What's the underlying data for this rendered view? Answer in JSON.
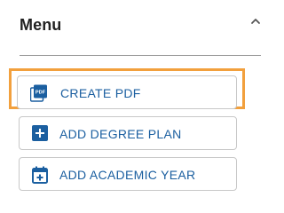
{
  "menu": {
    "title": "Menu",
    "toggle_icon": "chevron-up-icon"
  },
  "buttons": [
    {
      "label": "CREATE PDF",
      "icon": "pdf-file-icon",
      "focused": true
    },
    {
      "label": "ADD DEGREE PLAN",
      "icon": "plus-square-icon",
      "focused": false
    },
    {
      "label": "ADD ACADEMIC YEAR",
      "icon": "calendar-add-icon",
      "focused": false
    }
  ],
  "colors": {
    "accent": "#1b5fa0",
    "focus": "#f2a03d",
    "title": "#222222"
  }
}
